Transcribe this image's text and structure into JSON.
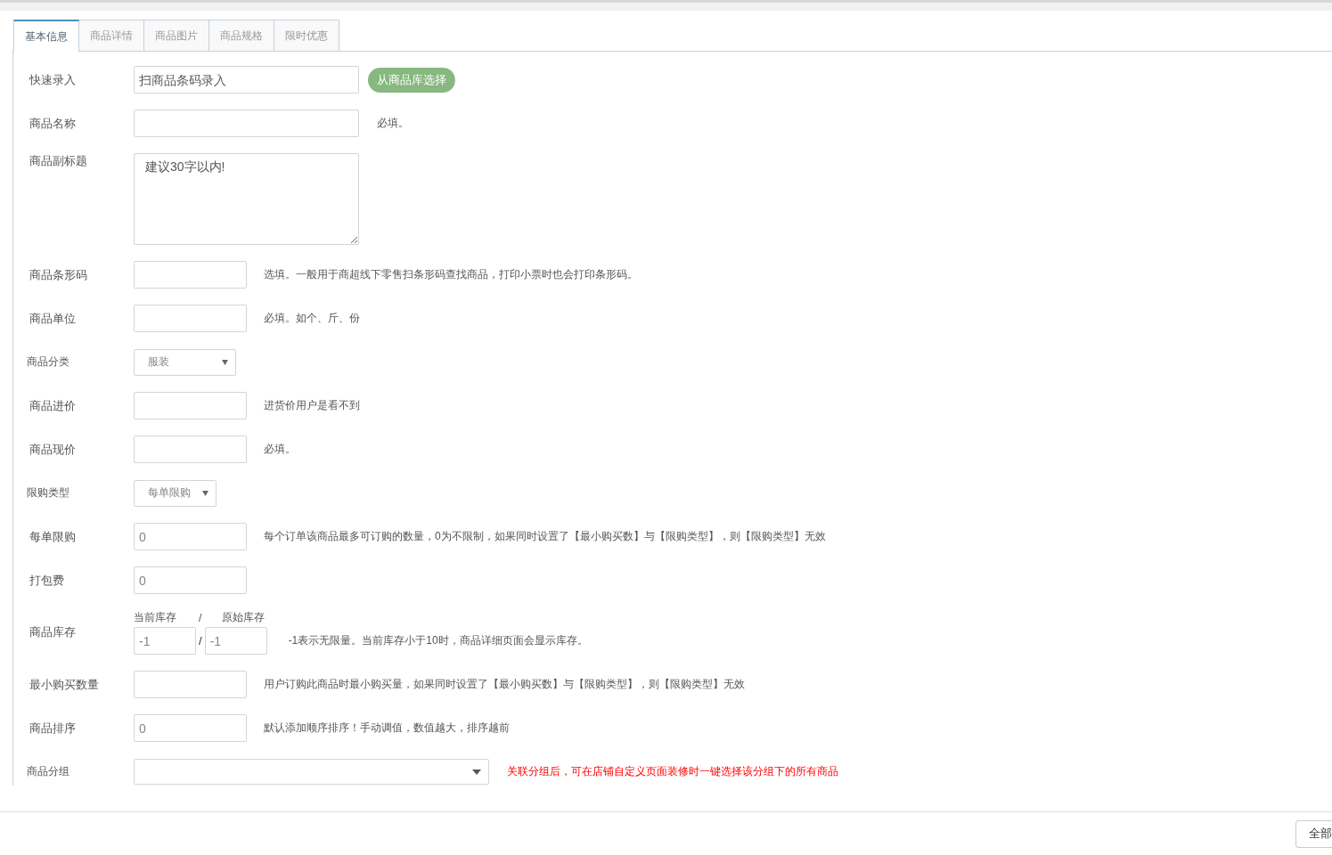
{
  "tabs": [
    {
      "label": "基本信息",
      "selected": true
    },
    {
      "label": "商品详情",
      "selected": false
    },
    {
      "label": "商品图片",
      "selected": false
    },
    {
      "label": "商品规格",
      "selected": false
    },
    {
      "label": "限时优惠",
      "selected": false
    }
  ],
  "fields": [
    {
      "kind": "wide_input",
      "label": "快速录入",
      "placeholder": "扫商品条码录入",
      "button": "从商品库选择"
    },
    {
      "kind": "wide_input",
      "label": "商品名称",
      "hint": "必填。"
    },
    {
      "kind": "textarea",
      "label": "商品副标题",
      "placeholder": "建议30字以内!"
    },
    {
      "kind": "input",
      "label": "商品条形码",
      "hint": "选填。一般用于商超线下零售扫条形码查找商品，打印小票时也会打印条形码。"
    },
    {
      "kind": "input",
      "label": "商品单位",
      "hint": "必填。如个、斤、份"
    },
    {
      "kind": "select",
      "label": "商品分类",
      "value": "服装"
    },
    {
      "kind": "input",
      "label": "商品进价",
      "hint": "进货价用户是看不到"
    },
    {
      "kind": "input",
      "label": "商品现价",
      "hint": "必填。"
    },
    {
      "kind": "short_select",
      "label": "限购类型",
      "value": "每单限购"
    },
    {
      "kind": "input",
      "label": "每单限购",
      "value": "0",
      "hint": "每个订单该商品最多可订购的数量，0为不限制，如果同时设置了【最小购买数】与【限购类型】，则【限购类型】无效"
    },
    {
      "kind": "input",
      "label": "打包费",
      "value": "0"
    },
    {
      "kind": "stock",
      "label": "商品库存",
      "current_label": "当前库存",
      "separator": "/",
      "original_label": "原始库存",
      "current": "-1",
      "field_separator": "/",
      "original": "-1",
      "hint": "-1表示无限量。当前库存小于10时，商品详细页面会显示库存。"
    },
    {
      "kind": "input",
      "label": "最小购买数量",
      "hint": "用户订购此商品时最小购买量，如果同时设置了【最小购买数】与【限购类型】，则【限购类型】无效"
    },
    {
      "kind": "input",
      "label": "商品排序",
      "value": "0",
      "hint": "默认添加顺序排序！手动调值，数值越大，排序越前"
    },
    {
      "kind": "wide_select",
      "label": "商品分组",
      "hint": "关联分组后，可在店铺自定义页面装修时一键选择该分组下的所有商品",
      "warning": true
    }
  ],
  "footer": {
    "button": "全部"
  }
}
